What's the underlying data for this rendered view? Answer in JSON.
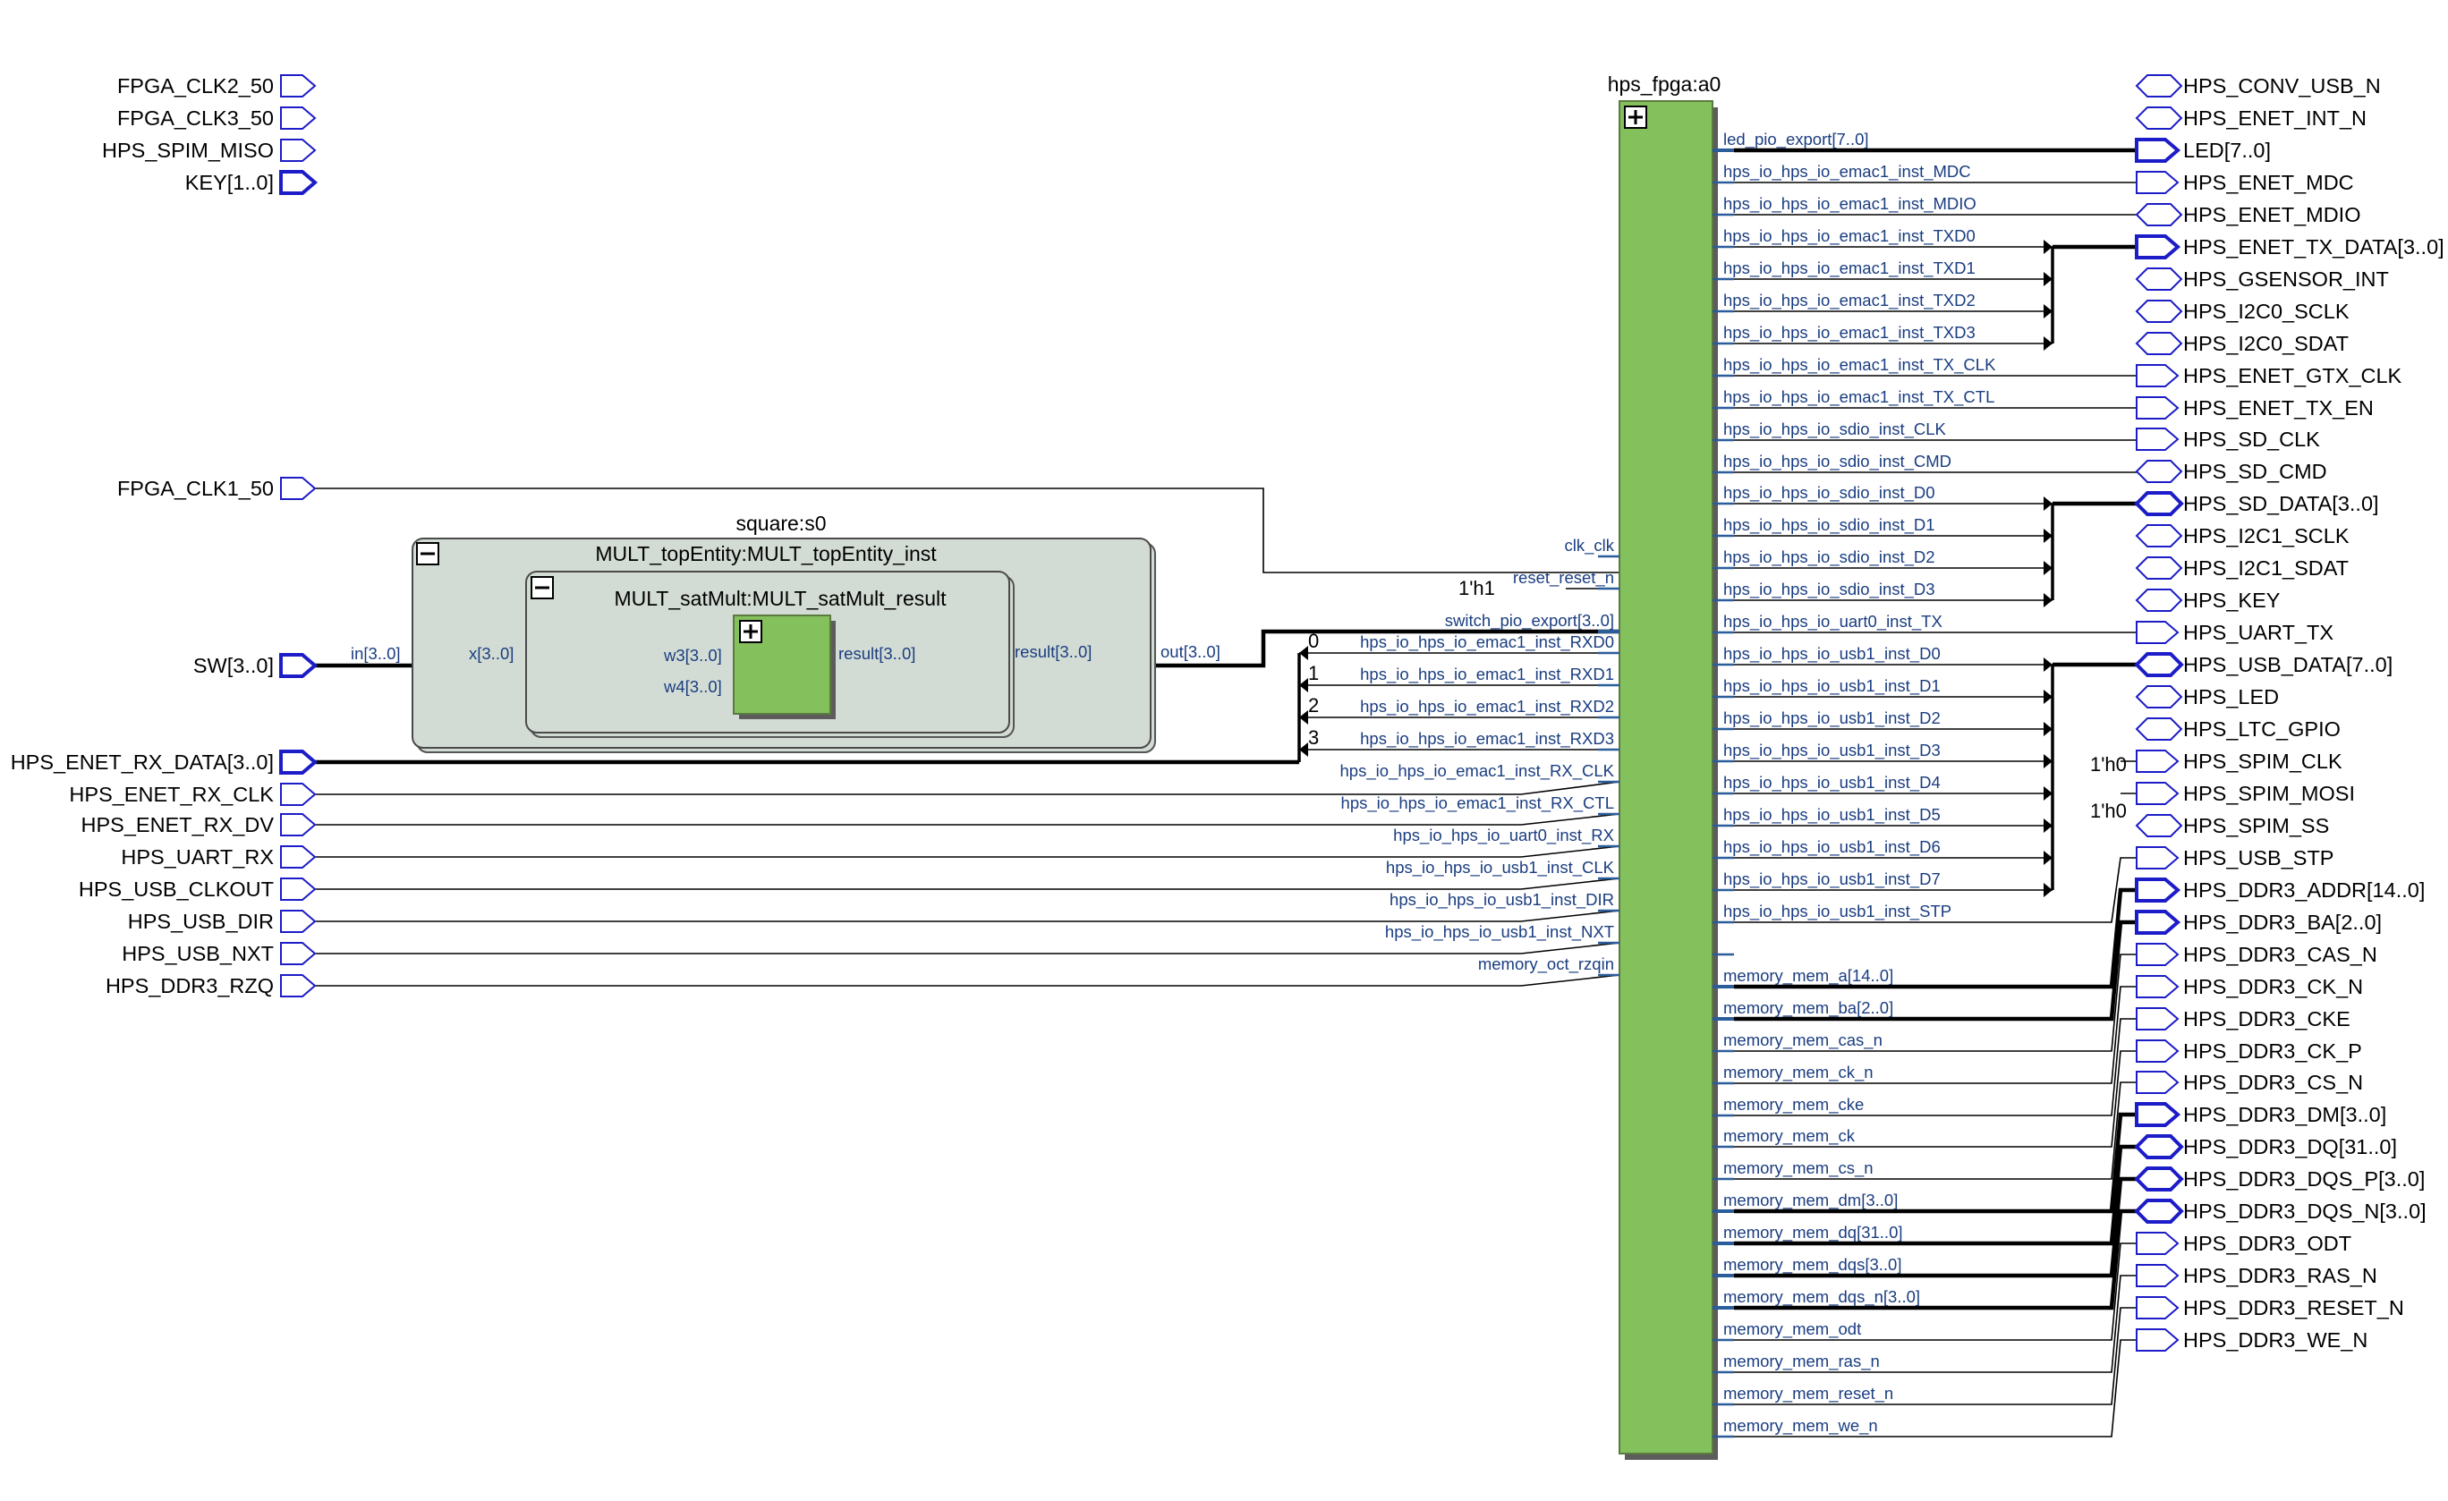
{
  "colors": {
    "port_outline": "#1c1cc8",
    "wire": "#000000",
    "internal_wire": "#2a5d9a",
    "block_green": "#84c05c",
    "container_gray": "#d3dcd4",
    "text": "#000000",
    "internal_label": "#1a3d80"
  },
  "left_ports": [
    {
      "label": "FPGA_CLK2_50",
      "bus": false
    },
    {
      "label": "FPGA_CLK3_50",
      "bus": false
    },
    {
      "label": "HPS_SPIM_MISO",
      "bus": false
    },
    {
      "label": "KEY[1..0]",
      "bus": true
    },
    {
      "label": "FPGA_CLK1_50",
      "bus": false
    },
    {
      "label": "SW[3..0]",
      "bus": true
    },
    {
      "label": "HPS_ENET_RX_DATA[3..0]",
      "bus": true
    },
    {
      "label": "HPS_ENET_RX_CLK",
      "bus": false
    },
    {
      "label": "HPS_ENET_RX_DV",
      "bus": false
    },
    {
      "label": "HPS_UART_RX",
      "bus": false
    },
    {
      "label": "HPS_USB_CLKOUT",
      "bus": false
    },
    {
      "label": "HPS_USB_DIR",
      "bus": false
    },
    {
      "label": "HPS_USB_NXT",
      "bus": false
    },
    {
      "label": "HPS_DDR3_RZQ",
      "bus": false
    }
  ],
  "square": {
    "title": "square:s0",
    "top_title": "MULT_topEntity:MULT_topEntity_inst",
    "sat_title": "MULT_satMult:MULT_satMult_result",
    "in_label": "in[3..0]",
    "x_label": "x[3..0]",
    "w3_label": "w3[3..0]",
    "w4_label": "w4[3..0]",
    "result_inner": "result[3..0]",
    "result_outer": "result[3..0]",
    "out_label": "out[3..0]"
  },
  "hps": {
    "title": "hps_fpga:a0",
    "left_pins": [
      "clk_clk",
      "reset_reset_n",
      "switch_pio_export[3..0]",
      "hps_io_hps_io_emac1_inst_RXD0",
      "hps_io_hps_io_emac1_inst_RXD1",
      "hps_io_hps_io_emac1_inst_RXD2",
      "hps_io_hps_io_emac1_inst_RXD3",
      "hps_io_hps_io_emac1_inst_RX_CLK",
      "hps_io_hps_io_emac1_inst_RX_CTL",
      "hps_io_hps_io_uart0_inst_RX",
      "hps_io_hps_io_usb1_inst_CLK",
      "hps_io_hps_io_usb1_inst_DIR",
      "hps_io_hps_io_usb1_inst_NXT",
      "memory_oct_rzqin"
    ],
    "right_pins": [
      "led_pio_export[7..0]",
      "hps_io_hps_io_emac1_inst_MDC",
      "hps_io_hps_io_emac1_inst_MDIO",
      "hps_io_hps_io_emac1_inst_TXD0",
      "hps_io_hps_io_emac1_inst_TXD1",
      "hps_io_hps_io_emac1_inst_TXD2",
      "hps_io_hps_io_emac1_inst_TXD3",
      "hps_io_hps_io_emac1_inst_TX_CLK",
      "hps_io_hps_io_emac1_inst_TX_CTL",
      "hps_io_hps_io_sdio_inst_CLK",
      "hps_io_hps_io_sdio_inst_CMD",
      "hps_io_hps_io_sdio_inst_D0",
      "hps_io_hps_io_sdio_inst_D1",
      "hps_io_hps_io_sdio_inst_D2",
      "hps_io_hps_io_sdio_inst_D3",
      "hps_io_hps_io_uart0_inst_TX",
      "hps_io_hps_io_usb1_inst_D0",
      "hps_io_hps_io_usb1_inst_D1",
      "hps_io_hps_io_usb1_inst_D2",
      "hps_io_hps_io_usb1_inst_D3",
      "hps_io_hps_io_usb1_inst_D4",
      "hps_io_hps_io_usb1_inst_D5",
      "hps_io_hps_io_usb1_inst_D6",
      "hps_io_hps_io_usb1_inst_D7",
      "hps_io_hps_io_usb1_inst_STP",
      "",
      "memory_mem_a[14..0]",
      "memory_mem_ba[2..0]",
      "memory_mem_cas_n",
      "memory_mem_ck_n",
      "memory_mem_cke",
      "memory_mem_ck",
      "memory_mem_cs_n",
      "memory_mem_dm[3..0]",
      "memory_mem_dq[31..0]",
      "memory_mem_dqs[3..0]",
      "memory_mem_dqs_n[3..0]",
      "memory_mem_odt",
      "memory_mem_ras_n",
      "memory_mem_reset_n",
      "memory_mem_we_n"
    ]
  },
  "right_ports": [
    {
      "label": "HPS_CONV_USB_N",
      "kind": "bidir",
      "bus": false
    },
    {
      "label": "HPS_ENET_INT_N",
      "kind": "bidir",
      "bus": false
    },
    {
      "label": "LED[7..0]",
      "kind": "out",
      "bus": true
    },
    {
      "label": "HPS_ENET_MDC",
      "kind": "out",
      "bus": false
    },
    {
      "label": "HPS_ENET_MDIO",
      "kind": "bidir",
      "bus": false
    },
    {
      "label": "HPS_ENET_TX_DATA[3..0]",
      "kind": "out",
      "bus": true
    },
    {
      "label": "HPS_GSENSOR_INT",
      "kind": "bidir",
      "bus": false
    },
    {
      "label": "HPS_I2C0_SCLK",
      "kind": "bidir",
      "bus": false
    },
    {
      "label": "HPS_I2C0_SDAT",
      "kind": "bidir",
      "bus": false
    },
    {
      "label": "HPS_ENET_GTX_CLK",
      "kind": "out",
      "bus": false
    },
    {
      "label": "HPS_ENET_TX_EN",
      "kind": "out",
      "bus": false
    },
    {
      "label": "HPS_SD_CLK",
      "kind": "out",
      "bus": false
    },
    {
      "label": "HPS_SD_CMD",
      "kind": "bidir",
      "bus": false
    },
    {
      "label": "HPS_SD_DATA[3..0]",
      "kind": "bidir",
      "bus": true
    },
    {
      "label": "HPS_I2C1_SCLK",
      "kind": "bidir",
      "bus": false
    },
    {
      "label": "HPS_I2C1_SDAT",
      "kind": "bidir",
      "bus": false
    },
    {
      "label": "HPS_KEY",
      "kind": "bidir",
      "bus": false
    },
    {
      "label": "HPS_UART_TX",
      "kind": "out",
      "bus": false
    },
    {
      "label": "HPS_USB_DATA[7..0]",
      "kind": "bidir",
      "bus": true
    },
    {
      "label": "HPS_LED",
      "kind": "bidir",
      "bus": false
    },
    {
      "label": "HPS_LTC_GPIO",
      "kind": "bidir",
      "bus": false
    },
    {
      "label": "HPS_SPIM_CLK",
      "kind": "out",
      "bus": false
    },
    {
      "label": "HPS_SPIM_MOSI",
      "kind": "out",
      "bus": false
    },
    {
      "label": "HPS_SPIM_SS",
      "kind": "bidir",
      "bus": false
    },
    {
      "label": "HPS_USB_STP",
      "kind": "out",
      "bus": false
    },
    {
      "label": "HPS_DDR3_ADDR[14..0]",
      "kind": "out",
      "bus": true
    },
    {
      "label": "HPS_DDR3_BA[2..0]",
      "kind": "out",
      "bus": true
    },
    {
      "label": "HPS_DDR3_CAS_N",
      "kind": "out",
      "bus": false
    },
    {
      "label": "HPS_DDR3_CK_N",
      "kind": "out",
      "bus": false
    },
    {
      "label": "HPS_DDR3_CKE",
      "kind": "out",
      "bus": false
    },
    {
      "label": "HPS_DDR3_CK_P",
      "kind": "out",
      "bus": false
    },
    {
      "label": "HPS_DDR3_CS_N",
      "kind": "out",
      "bus": false
    },
    {
      "label": "HPS_DDR3_DM[3..0]",
      "kind": "out",
      "bus": true
    },
    {
      "label": "HPS_DDR3_DQ[31..0]",
      "kind": "bidir",
      "bus": true
    },
    {
      "label": "HPS_DDR3_DQS_P[3..0]",
      "kind": "bidir",
      "bus": true
    },
    {
      "label": "HPS_DDR3_DQS_N[3..0]",
      "kind": "bidir",
      "bus": true
    },
    {
      "label": "HPS_DDR3_ODT",
      "kind": "out",
      "bus": false
    },
    {
      "label": "HPS_DDR3_RAS_N",
      "kind": "out",
      "bus": false
    },
    {
      "label": "HPS_DDR3_RESET_N",
      "kind": "out",
      "bus": false
    },
    {
      "label": "HPS_DDR3_WE_N",
      "kind": "out",
      "bus": false
    }
  ],
  "constants": {
    "reset": "1'h1",
    "spim_clk": "1'h0",
    "spim_mosi": "1'h0"
  },
  "bit_indices": [
    "0",
    "1",
    "2",
    "3"
  ]
}
